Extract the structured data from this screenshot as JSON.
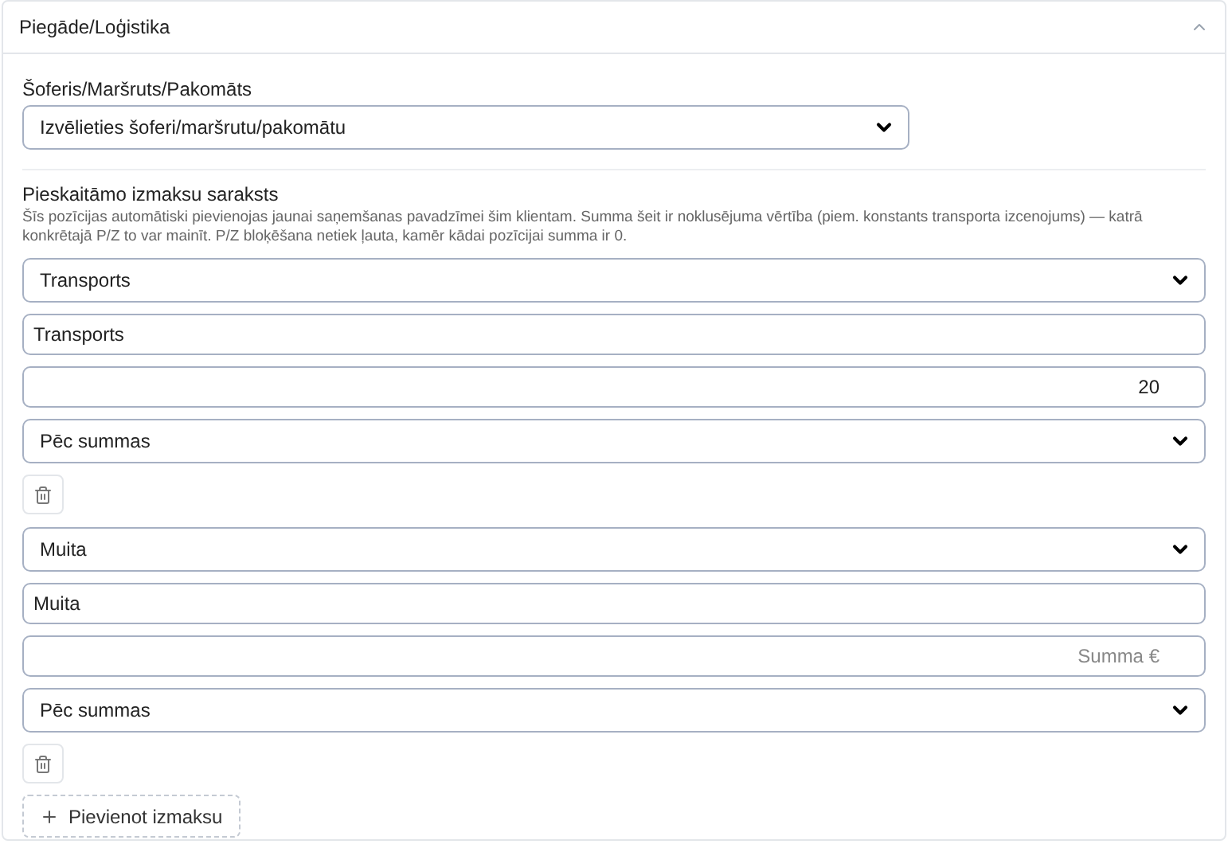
{
  "panel": {
    "title": "Piegāde/Loģistika",
    "expanded": true
  },
  "driver": {
    "label": "Šoferis/Maršruts/Pakomāts",
    "value": "Izvēlieties šoferi/maršrutu/pakomātu"
  },
  "fees": {
    "label": "Pieskaitāmo izmaksu saraksts",
    "description": "Šīs pozīcijas automātiski pievienojas jaunai saņemšanas pavadzīmei šim klientam. Summa šeit ir noklusējuma vērtība (piem. konstants transporta izcenojums) — katrā konkrētajā P/Z to var mainīt. P/Z bloķēšana netiek ļauta, kamēr kādai pozīcijai summa ir 0.",
    "items": [
      {
        "type": "Transports",
        "name": "Transports",
        "amount": {
          "value": "20"
        },
        "mode": "Pēc summas"
      },
      {
        "type": "Muita",
        "name": "Muita",
        "amount": {
          "placeholder": "Summa €"
        },
        "mode": "Pēc summas"
      }
    ],
    "add_button": "Pievienot izmaksu"
  }
}
